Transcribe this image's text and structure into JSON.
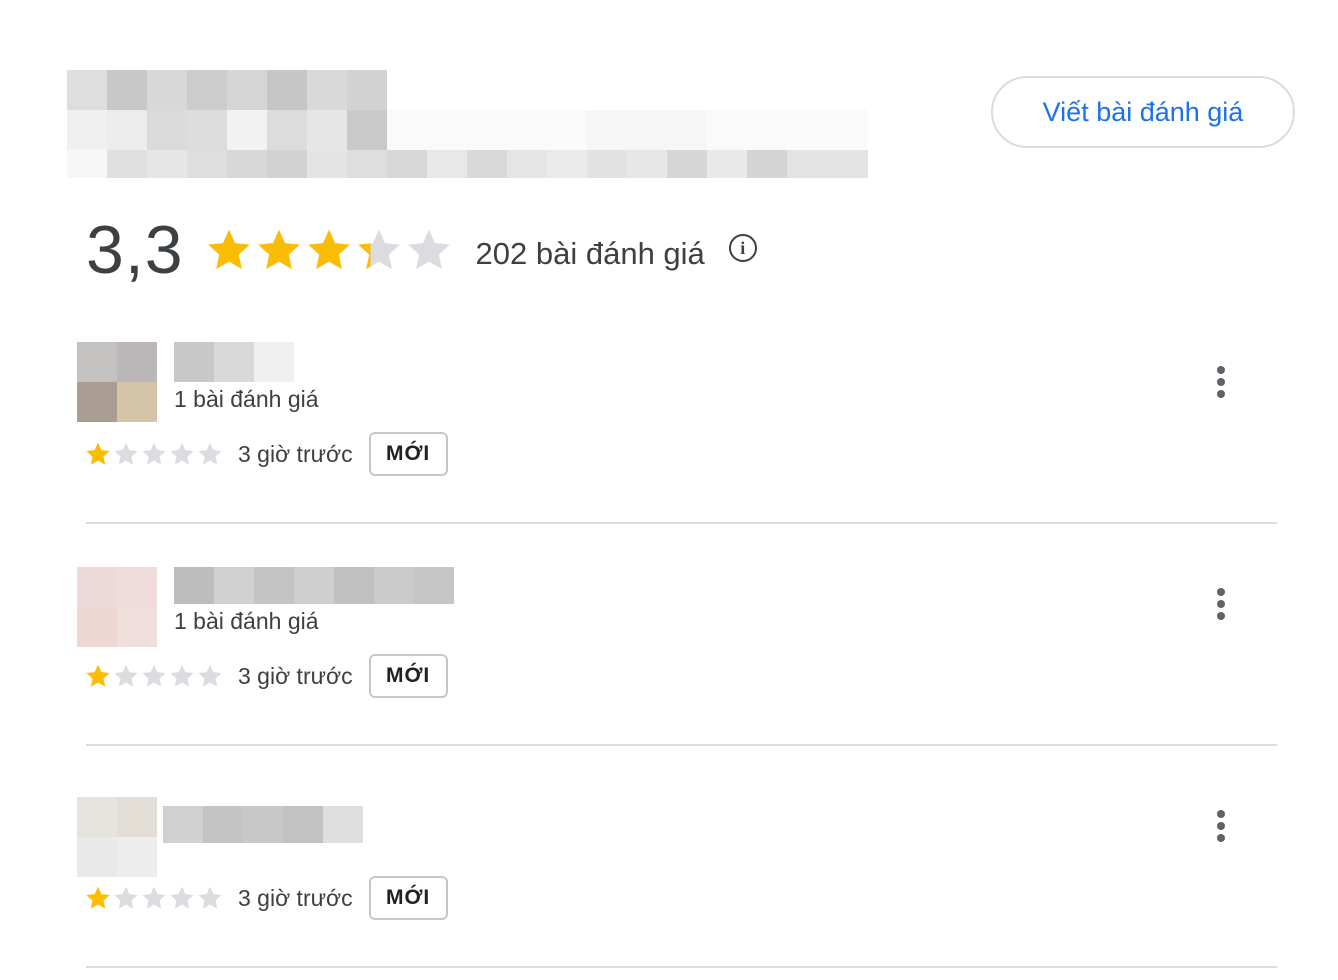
{
  "header": {
    "write_review_label": "Viết bài đánh giá"
  },
  "summary": {
    "rating": "3,3",
    "rating_value": 3.3,
    "rating_max": 5,
    "review_count_text": "202 bài đánh giá",
    "info_icon": "info-icon"
  },
  "colors": {
    "star_filled": "#fbbc04",
    "star_empty": "#dadce0",
    "accent": "#1a73e8"
  },
  "reviews": [
    {
      "reviewer_meta": "1 bài đánh giá",
      "stars": 1,
      "time_ago": "3 giờ trước",
      "badge": "MỚI"
    },
    {
      "reviewer_meta": "1 bài đánh giá",
      "stars": 1,
      "time_ago": "3 giờ trước",
      "badge": "MỚI"
    },
    {
      "reviewer_meta": "",
      "stars": 1,
      "time_ago": "3 giờ trước",
      "badge": "MỚI"
    }
  ]
}
